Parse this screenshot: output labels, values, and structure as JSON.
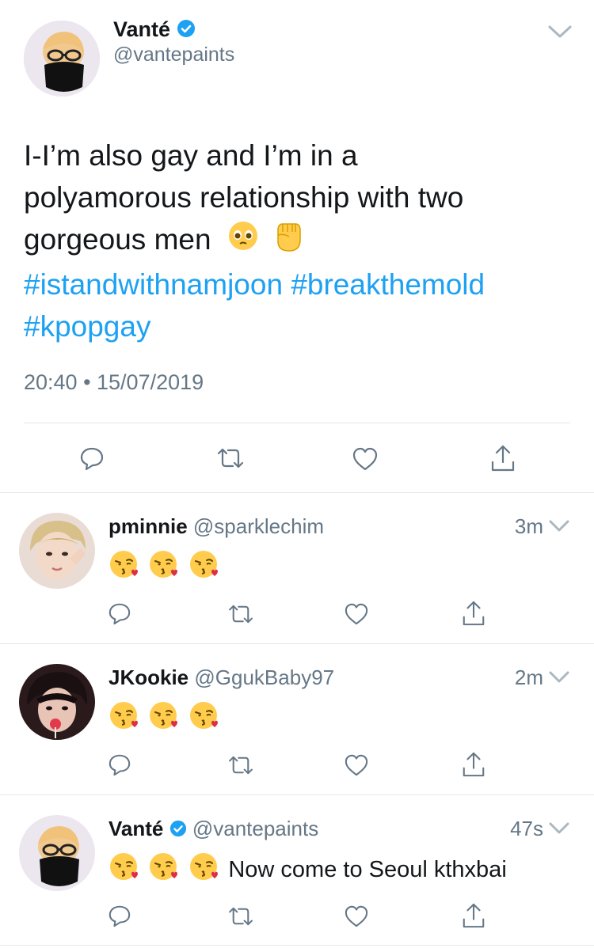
{
  "main_tweet": {
    "name": "Vanté",
    "handle": "@vantepaints",
    "text_line1": "I-I’m also gay and I’m in a",
    "text_line2": "polyamorous relationship with two",
    "text_line3": "gorgeous men",
    "hashtags": [
      "#istandwithnamjoon",
      "#breakthemold",
      "#kpopgay"
    ],
    "timestamp": "20:40 • 15/07/2019",
    "emoji_names": [
      "pleading-face-emoji",
      "raised-fist-emoji"
    ]
  },
  "replies": [
    {
      "name": "pminnie",
      "handle": "@sparklechim",
      "time": "3m",
      "verified": false,
      "emoji_names": [
        "kissing-face-emoji",
        "kissing-face-emoji",
        "kissing-face-emoji"
      ],
      "text": ""
    },
    {
      "name": "JKookie",
      "handle": "@GgukBaby97",
      "time": "2m",
      "verified": false,
      "emoji_names": [
        "kissing-face-emoji",
        "kissing-face-emoji",
        "kissing-face-emoji"
      ],
      "text": ""
    },
    {
      "name": "Vanté",
      "handle": "@vantepaints",
      "time": "47s",
      "verified": true,
      "emoji_names": [
        "kissing-face-emoji",
        "kissing-face-emoji",
        "kissing-face-emoji"
      ],
      "text": "Now come to Seoul kthxbai"
    }
  ],
  "actions": [
    "reply-icon",
    "retweet-icon",
    "like-icon",
    "share-icon"
  ],
  "colors": {
    "accent": "#1da1f2",
    "muted": "#657786",
    "text": "#14171a",
    "divider": "#e1e8ed",
    "emoji": "#ffcc4d"
  }
}
